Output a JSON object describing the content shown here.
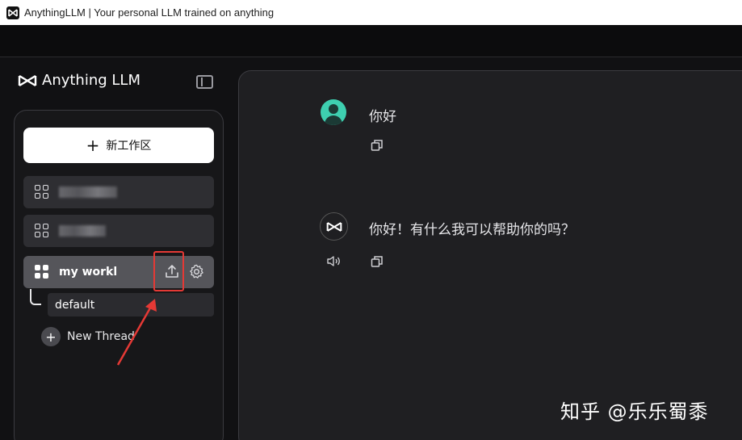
{
  "window": {
    "title": "AnythingLLM | Your personal LLM trained on anything"
  },
  "sidebar": {
    "brand": "Anything LLM",
    "new_workspace_label": "新工作区",
    "workspaces": [
      {
        "name": "",
        "redacted": true
      },
      {
        "name": "",
        "redacted": true
      },
      {
        "name": "my workl",
        "active": true
      }
    ],
    "threads": [
      {
        "label": "default"
      }
    ],
    "new_thread_label": "New Thread"
  },
  "chat": {
    "messages": [
      {
        "role": "user",
        "text": "你好"
      },
      {
        "role": "assistant",
        "text": "你好！有什么我可以帮助你的吗？"
      }
    ]
  },
  "watermark": "知乎 @乐乐蜀黍",
  "colors": {
    "accent_user_avatar": "#3ecfb0",
    "highlight": "#e53935"
  }
}
